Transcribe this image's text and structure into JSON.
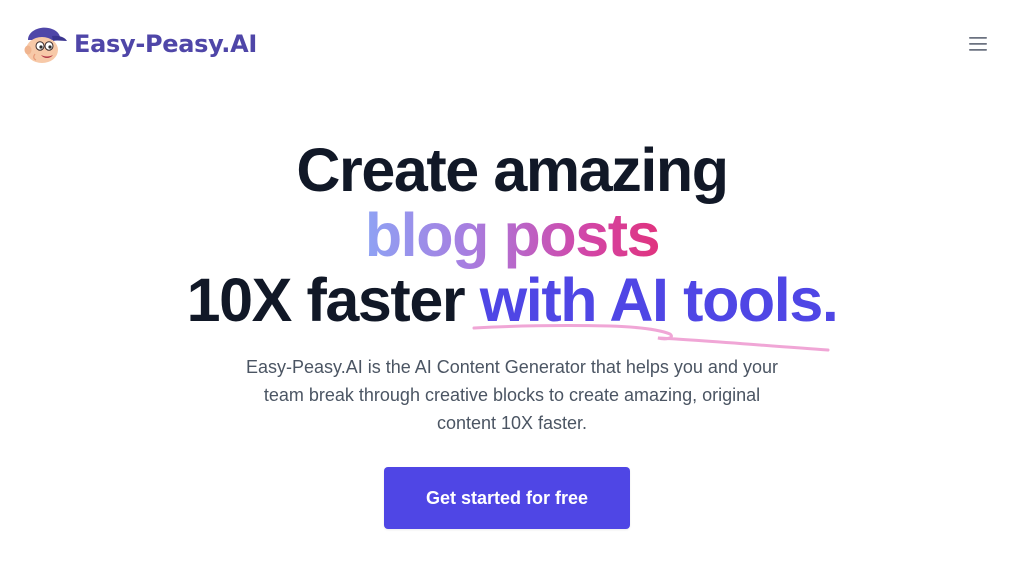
{
  "header": {
    "logo_text": "Easy-Peasy.AI",
    "logo_icon": "mascot-icon",
    "menu_icon": "hamburger-menu-icon"
  },
  "hero": {
    "line1": "Create amazing",
    "line2": "blog posts",
    "line3_plain": "10X faster ",
    "line3_accent": "with AI tools.",
    "description_lines": [
      "Easy-Peasy.AI is the AI Content Generator that helps you and your",
      "team break through creative blocks to create amazing, original",
      "content 10X faster."
    ],
    "cta_label": "Get started for free"
  },
  "colors": {
    "brand": "#4f46a8",
    "accent": "#4f46e5",
    "heading": "#111827",
    "body_text": "#4b5563",
    "gradient": [
      "#8ea2f4",
      "#a77ee0",
      "#d246a8",
      "#e0337e"
    ],
    "scribble": "#f0a6d6"
  }
}
